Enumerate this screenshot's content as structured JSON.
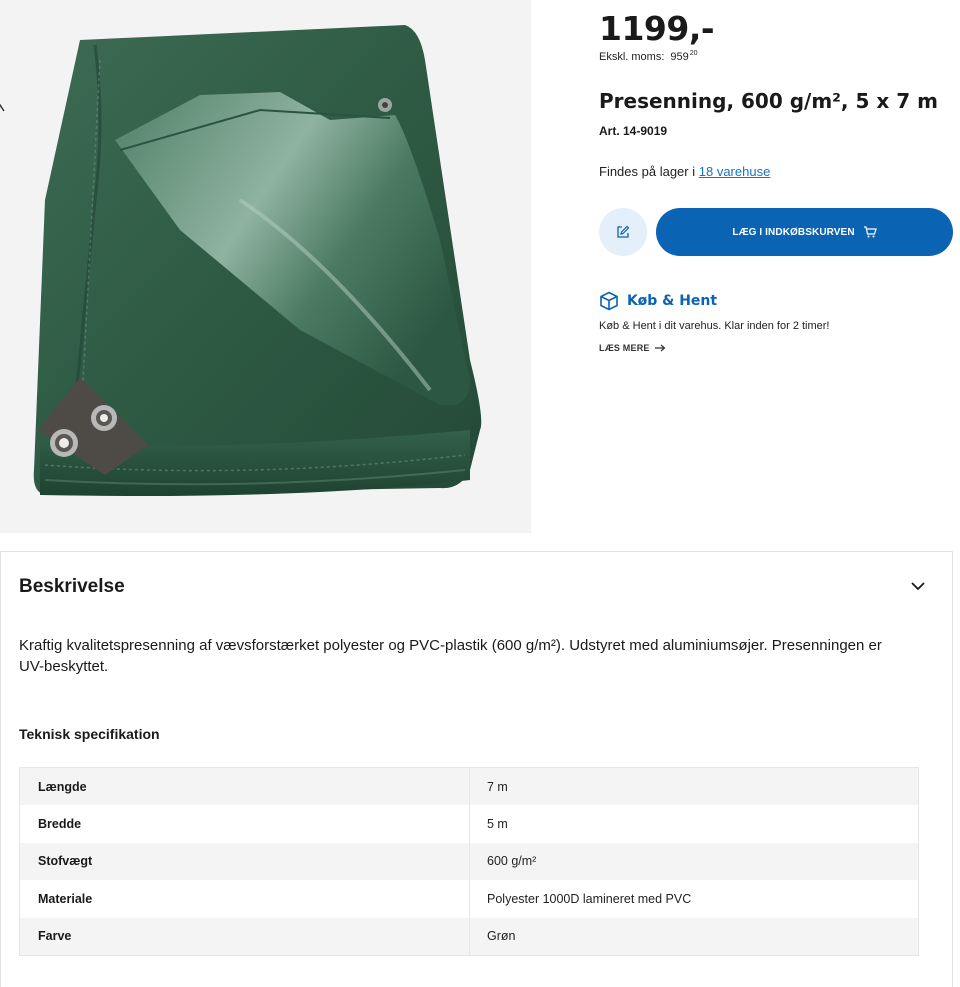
{
  "product": {
    "price": "1199,-",
    "price_ex_label": "Ekskl. moms:",
    "price_ex_main": "959",
    "price_ex_cents": "20",
    "title": "Presenning, 600 g/m², 5 x 7 m",
    "article": "Art. 14-9019",
    "stock_prefix": "Findes på lager i",
    "stock_link": "18 varehuse",
    "add_to_cart": "LÆG I INDKØBSKURVEN",
    "koeb_hent_title": "Køb & Hent",
    "koeb_hent_desc": "Køb & Hent i dit varehus. Klar inden for 2 timer!",
    "read_more": "LÆS MERE"
  },
  "description": {
    "heading": "Beskrivelse",
    "text": "Kraftig kvalitetspresenning af vævsforstærket polyester og PVC-plastik (600 g/m²). Udstyret med aluminiumsøjer. Presenningen er UV-beskyttet.",
    "spec_heading": "Teknisk specifikation",
    "specs": [
      {
        "label": "Længde",
        "value": "7 m"
      },
      {
        "label": "Bredde",
        "value": "5 m"
      },
      {
        "label": "Stofvægt",
        "value": "600 g/m²"
      },
      {
        "label": "Materiale",
        "value": "Polyester 1000D lamineret med PVC"
      },
      {
        "label": "Farve",
        "value": "Grøn"
      }
    ]
  },
  "colors": {
    "primary_blue": "#0a63b3",
    "link_blue": "#1a73c6",
    "tarp_green": "#2f5a43",
    "light_blue_bg": "#e4eff9"
  }
}
